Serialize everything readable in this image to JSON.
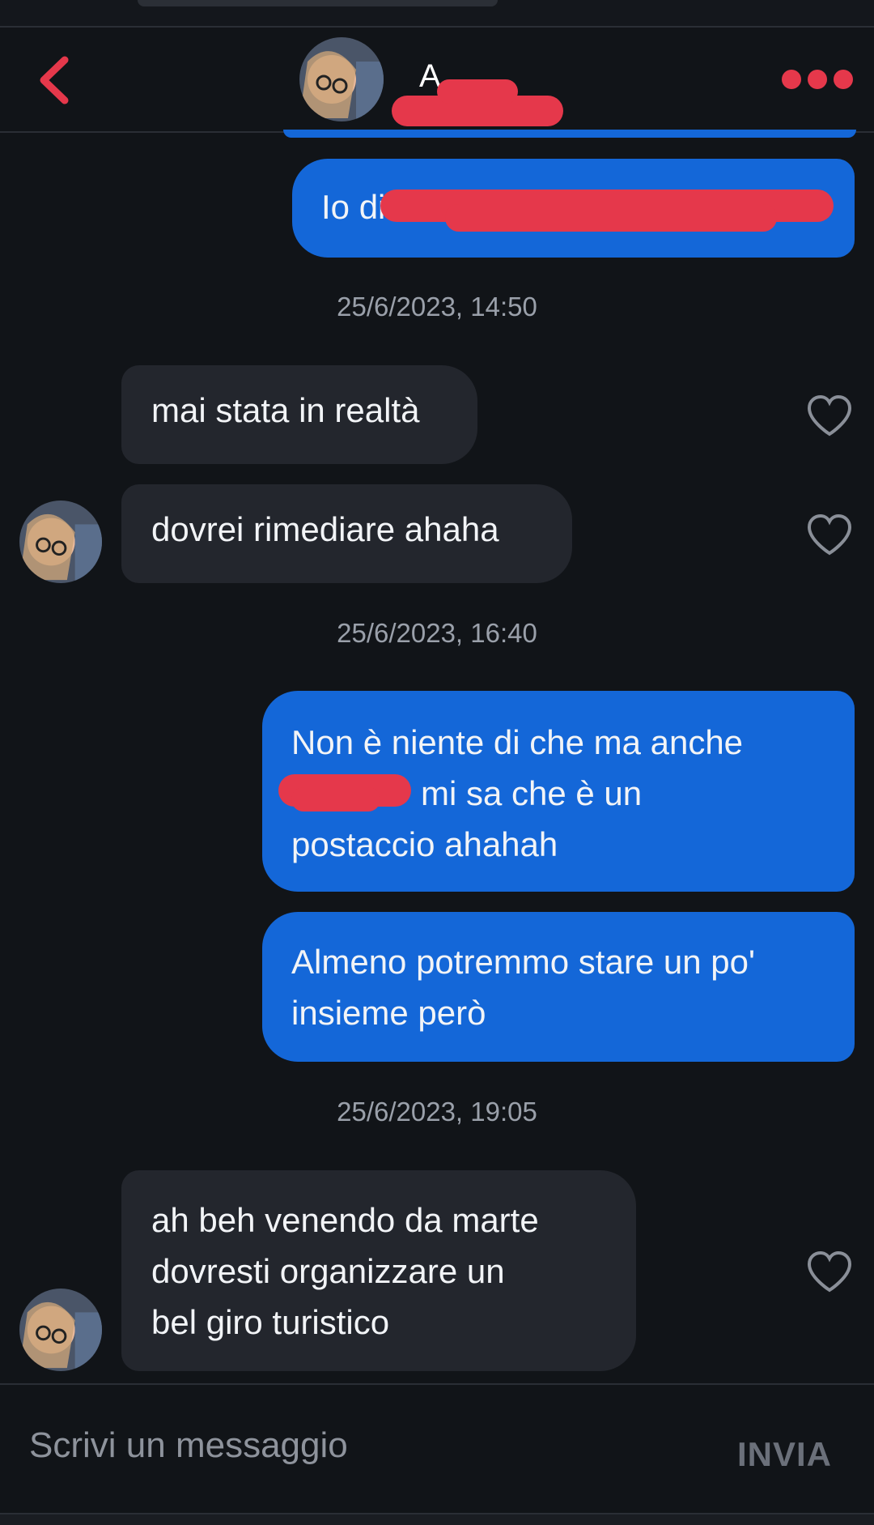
{
  "header": {
    "contact_name": "A"
  },
  "messages": [
    {
      "type": "sent",
      "text": "Io di"
    },
    {
      "type": "timestamp",
      "text": "25/6/2023, 14:50"
    },
    {
      "type": "received",
      "text": "mai stata in realtà"
    },
    {
      "type": "received",
      "text": "dovrei rimediare ahaha"
    },
    {
      "type": "timestamp",
      "text": "25/6/2023, 16:40"
    },
    {
      "type": "sent",
      "text_line1": "Non è niente di che ma anche",
      "text_line2": "mi sa che è un",
      "text_line3": "postaccio ahahah"
    },
    {
      "type": "sent",
      "text_line1": "Almeno potremmo stare un po'",
      "text_line2": "insieme però"
    },
    {
      "type": "timestamp",
      "text": "25/6/2023, 19:05"
    },
    {
      "type": "received",
      "text_line1": "ah beh venendo da marte",
      "text_line2": "dovresti organizzare un",
      "text_line3": "bel giro turistico"
    }
  ],
  "composer": {
    "placeholder": "Scrivi un messaggio",
    "send_label": "INVIA"
  },
  "colors": {
    "background": "#111418",
    "sent_bubble": "#1467d8",
    "received_bubble": "#23262d",
    "accent": "#e5384b"
  },
  "icons": [
    "back-chevron-icon",
    "more-dots-icon",
    "heart-icon"
  ]
}
